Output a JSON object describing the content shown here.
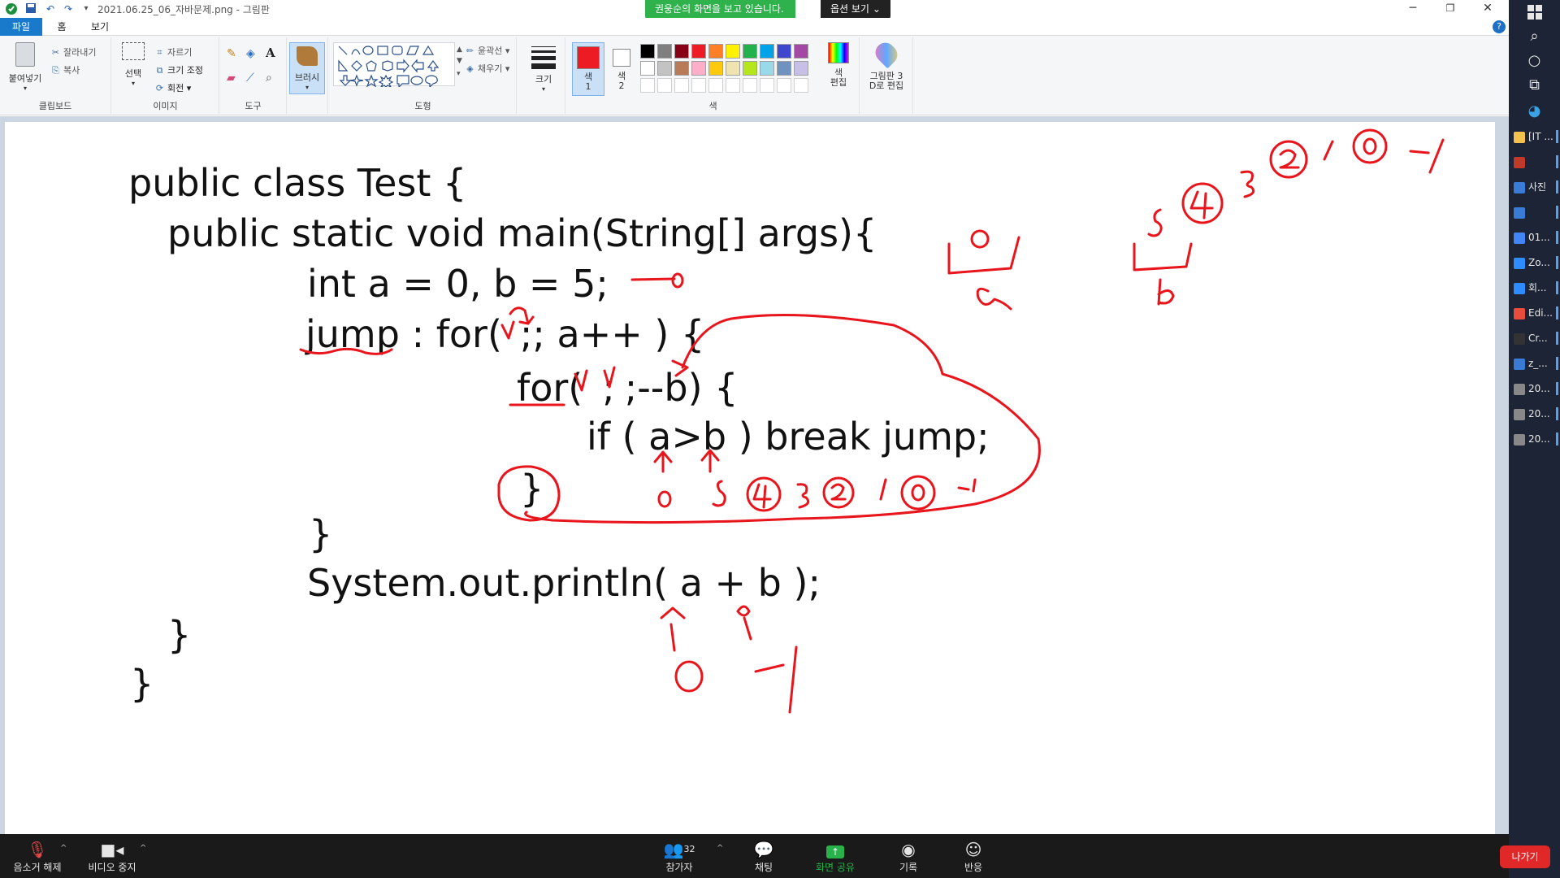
{
  "window": {
    "title": "2021.06.25_06_자바문제.png - 그림판"
  },
  "share": {
    "banner": "권웅순의 화면을 보고 있습니다.",
    "options": "옵션 보기"
  },
  "tabs": {
    "file": "파일",
    "home": "홈",
    "view": "보기"
  },
  "ribbon": {
    "clipboard": {
      "label": "클립보드",
      "paste": "붙여넣기",
      "cut": "잘라내기",
      "copy": "복사"
    },
    "image": {
      "label": "이미지",
      "select": "선택",
      "crop": "자르기",
      "resize": "크기 조정",
      "rotate": "회전"
    },
    "tools": {
      "label": "도구"
    },
    "brush": {
      "label": "브러시"
    },
    "shapes": {
      "label": "도형",
      "outline": "윤곽선",
      "fill": "채우기"
    },
    "size": {
      "label": "크기"
    },
    "colors": {
      "label": "색",
      "color1": "색\n1",
      "color1_a": "색",
      "color1_b": "1",
      "color2_a": "색",
      "color2_b": "2",
      "edit_a": "색",
      "edit_b": "편집",
      "paint3d_a": "그림판 3",
      "paint3d_b": "D로 편집",
      "active": "#e81123",
      "palette_row1": [
        "#000000",
        "#7f7f7f",
        "#880015",
        "#ed1c24",
        "#ff7f27",
        "#fff200",
        "#22b14c",
        "#00a2e8",
        "#3f48cc",
        "#a349a4"
      ],
      "palette_row2": [
        "#ffffff",
        "#c3c3c3",
        "#b97a57",
        "#ffaec9",
        "#ffc90e",
        "#efe4b0",
        "#b5e61d",
        "#99d9ea",
        "#7092be",
        "#c8bfe7"
      ]
    }
  },
  "code": {
    "line1": "public class Test {",
    "line2": "public static void main(String[] args){",
    "line3": "int a = 0, b = 5;",
    "line4a": "jump",
    "line4b": " : for(",
    "line4c": ";",
    "line4d": "; a++ ) {",
    "line5a": "for(",
    "line5b": ";",
    "line5c": ";--b) {",
    "line6": "if ( a>b ) break jump;",
    "line7": "}",
    "line8": "}",
    "line9": "System.out.println( a + b );",
    "line10": "}",
    "line11": "}"
  },
  "handwriting": {
    "note_a_zero": "0",
    "note_a_label": "a",
    "note_b_label": "b",
    "note_b_5": "5",
    "note_b_4": "4",
    "note_b_3": "3",
    "note_b_2": "2",
    "note_b_1": "1",
    "note_b_0": "0",
    "note_b_neg": "-1",
    "under_if_0": "0",
    "under_if_5": "5",
    "under_if_4": "4",
    "under_if_3": "3",
    "under_if_2": "2",
    "under_if_1": "1",
    "under_if_0b": "0",
    "under_if_neg": "-1",
    "bottom_0": "0",
    "bottom_neg": "-1",
    "line3_arrow_0": "0"
  },
  "taskbar": {
    "apps": [
      "[IT ...",
      "",
      "사진",
      "",
      "01...",
      "Zo...",
      "회...",
      "Edi...",
      "Cr...",
      "z_...",
      "20...",
      "20...",
      "20..."
    ]
  },
  "zoombar": {
    "mute": "음소거 해제",
    "video": "비디오 중지",
    "participants": "참가자",
    "participants_count": "32",
    "chat": "채팅",
    "share": "화면 공유",
    "record": "기록",
    "react": "반응",
    "leave": "나가기"
  }
}
